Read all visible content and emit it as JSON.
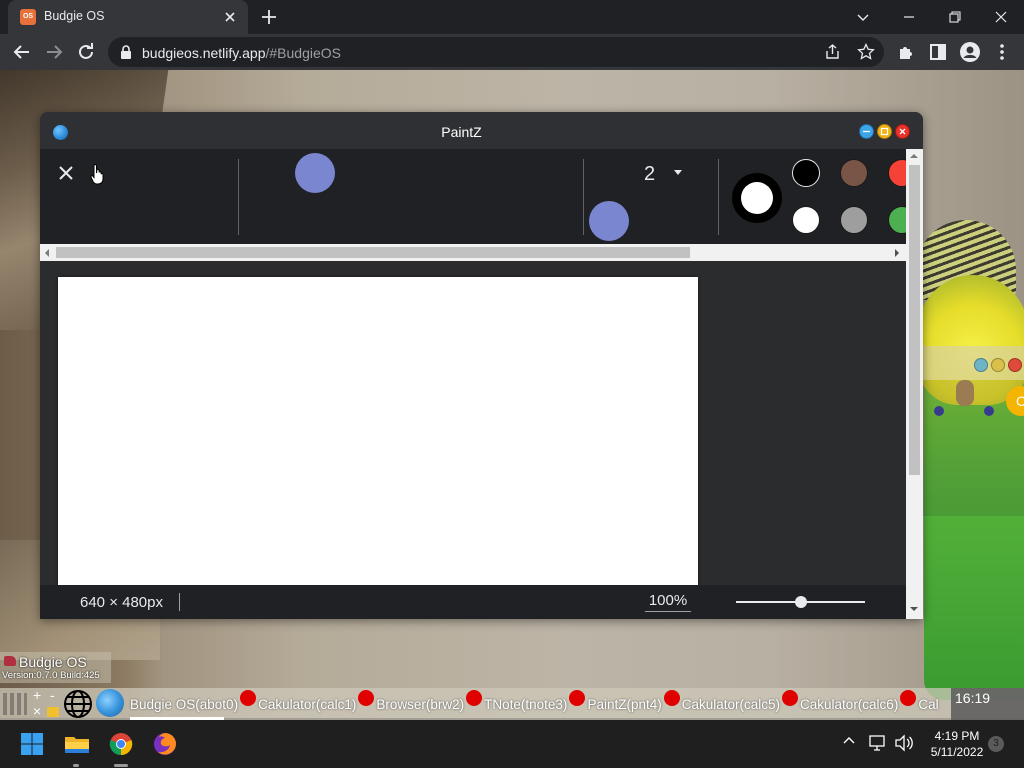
{
  "browser": {
    "tab_title": "Budgie OS",
    "tab_favicon_text": "OS",
    "url_host": "budgieos.netlify.app",
    "url_path": "/#BudgieOS"
  },
  "paintz": {
    "title": "PaintZ",
    "line_width": "2",
    "canvas_size": "640 × 480px",
    "zoom": "100%",
    "zoom_slider_fraction": 0.5,
    "primary_color": "#ffffff",
    "swatches_row1": [
      "#000000",
      "#795548",
      "#f44336"
    ],
    "swatches_row2": [
      "#ffffff",
      "#9e9e9e",
      "#4caf50"
    ]
  },
  "budgie_os": {
    "label": "Budgie OS",
    "version": "Version:0.7.0  Build:425",
    "taskbar_clock": "16:19",
    "quick_plus": "+",
    "quick_minus": "-",
    "quick_x": "×",
    "apps": [
      "Budgie OS(abot0)",
      "Cakulator(calc1)",
      "Browser(brw2)",
      "TNote(tnote3)",
      "PaintZ(pnt4)",
      "Cakulator(calc5)",
      "Cakulator(calc6)",
      "Cal"
    ]
  },
  "windows": {
    "time": "4:19 PM",
    "date": "5/11/2022",
    "notifications": "3"
  },
  "icons": {
    "tab": [
      "budgie-os-favicon",
      "close-icon",
      "plus-icon"
    ],
    "window": [
      "chevron-down-icon",
      "minimize-icon",
      "restore-icon",
      "close-icon"
    ],
    "toolbar": [
      "back-arrow-icon",
      "forward-arrow-icon",
      "reload-icon",
      "lock-icon",
      "share-icon",
      "star-icon",
      "extensions-icon",
      "side-panel-icon",
      "profile-icon",
      "more-icon"
    ]
  }
}
